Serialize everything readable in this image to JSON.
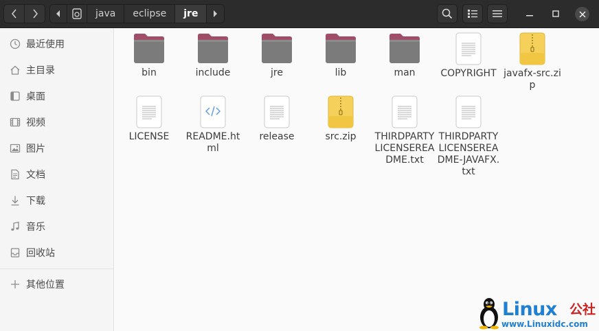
{
  "header": {
    "path": [
      "java",
      "eclipse",
      "jre"
    ],
    "icons": [
      "back-icon",
      "forward-icon",
      "search-icon",
      "list-view-icon",
      "menu-icon",
      "minimize-icon",
      "maximize-icon",
      "close-icon"
    ]
  },
  "sidebar": {
    "items": [
      {
        "label": "最近使用",
        "icon": "clock-icon"
      },
      {
        "label": "主目录",
        "icon": "home-icon"
      },
      {
        "label": "桌面",
        "icon": "desktop-icon"
      },
      {
        "label": "视频",
        "icon": "video-icon"
      },
      {
        "label": "图片",
        "icon": "picture-icon"
      },
      {
        "label": "文档",
        "icon": "document-icon"
      },
      {
        "label": "下载",
        "icon": "download-icon"
      },
      {
        "label": "音乐",
        "icon": "music-icon"
      },
      {
        "label": "回收站",
        "icon": "trash-icon"
      }
    ],
    "other": {
      "label": "其他位置",
      "icon": "plus-icon"
    }
  },
  "files": [
    {
      "name": "bin",
      "type": "folder"
    },
    {
      "name": "include",
      "type": "folder"
    },
    {
      "name": "jre",
      "type": "folder"
    },
    {
      "name": "lib",
      "type": "folder"
    },
    {
      "name": "man",
      "type": "folder"
    },
    {
      "name": "COPYRIGHT",
      "type": "text"
    },
    {
      "name": "javafx-src.zip",
      "type": "zip"
    },
    {
      "name": "LICENSE",
      "type": "text"
    },
    {
      "name": "README.html",
      "type": "html"
    },
    {
      "name": "release",
      "type": "text"
    },
    {
      "name": "src.zip",
      "type": "zip"
    },
    {
      "name": "THIRDPARTYLICENSEREADME.txt",
      "type": "text"
    },
    {
      "name": "THIRDPARTYLICENSEREADME-JAVAFX.txt",
      "type": "text"
    }
  ],
  "watermark": {
    "brand": "Linux",
    "brand_cn": "公社",
    "url": "www.Linuxidc.com"
  },
  "colors": {
    "folder_tab": "#a04d68",
    "folder_body": "#7b7b7b",
    "zip_body": "#f5d05a",
    "headerbar": "#2c2c2c",
    "watermark_blue": "#1f7fd1",
    "watermark_red": "#cc2222"
  }
}
